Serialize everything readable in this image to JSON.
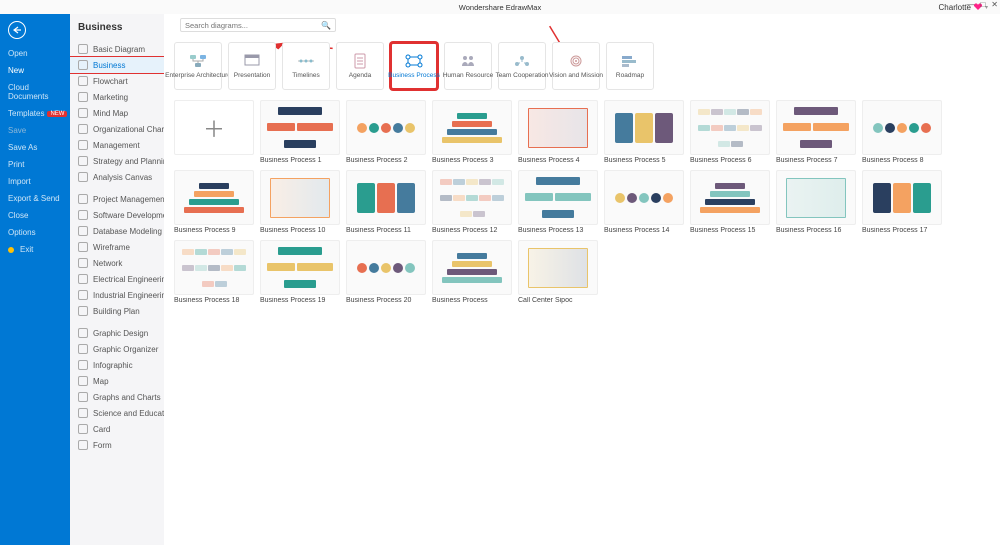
{
  "window": {
    "title": "Wondershare EdrawMax",
    "user": "Charlotte"
  },
  "sidebar": [
    {
      "label": "Open",
      "state": ""
    },
    {
      "label": "New",
      "state": "active"
    },
    {
      "label": "Cloud Documents",
      "state": ""
    },
    {
      "label": "Templates",
      "state": "",
      "badge": "NEW"
    },
    {
      "label": "Save",
      "state": "disabled"
    },
    {
      "label": "Save As",
      "state": ""
    },
    {
      "label": "Print",
      "state": ""
    },
    {
      "label": "Import",
      "state": ""
    },
    {
      "label": "Export & Send",
      "state": ""
    },
    {
      "label": "Close",
      "state": ""
    },
    {
      "label": "Options",
      "state": ""
    },
    {
      "label": "Exit",
      "state": "exit"
    }
  ],
  "pageTitle": "Business",
  "categories1": [
    "Basic Diagram",
    "Business",
    "Flowchart",
    "Marketing",
    "Mind Map",
    "Organizational Chart",
    "Management",
    "Strategy and Planning",
    "Analysis Canvas"
  ],
  "catSelected": 1,
  "categories2": [
    "Project Management",
    "Software Development",
    "Database Modeling",
    "Wireframe",
    "Network",
    "Electrical Engineering",
    "Industrial Engineering",
    "Building Plan"
  ],
  "categories3": [
    "Graphic Design",
    "Graphic Organizer",
    "Infographic",
    "Map",
    "Graphs and Charts",
    "Science and Education",
    "Card",
    "Form"
  ],
  "search": {
    "placeholder": "Search diagrams..."
  },
  "types": [
    "Enterprise Architecture",
    "Presentation",
    "Timelines",
    "Agenda",
    "Business Process",
    "Human Resource",
    "Team Cooperation",
    "Vision and Mission",
    "Roadmap"
  ],
  "typeSelected": 4,
  "templates": [
    "Business Process 1",
    "Business Process 2",
    "Business Process 3",
    "Business Process 4",
    "Business Process 5",
    "Business Process 6",
    "Business Process 7",
    "Business Process 8",
    "Business Process 9",
    "Business Process 10",
    "Business Process 11",
    "Business Process 12",
    "Business Process 13",
    "Business Process 14",
    "Business Process 15",
    "Business Process 16",
    "Business Process 17",
    "Business Process 18",
    "Business Process 19",
    "Business Process 20",
    "Business Process",
    "Call Center Sipoc"
  ]
}
